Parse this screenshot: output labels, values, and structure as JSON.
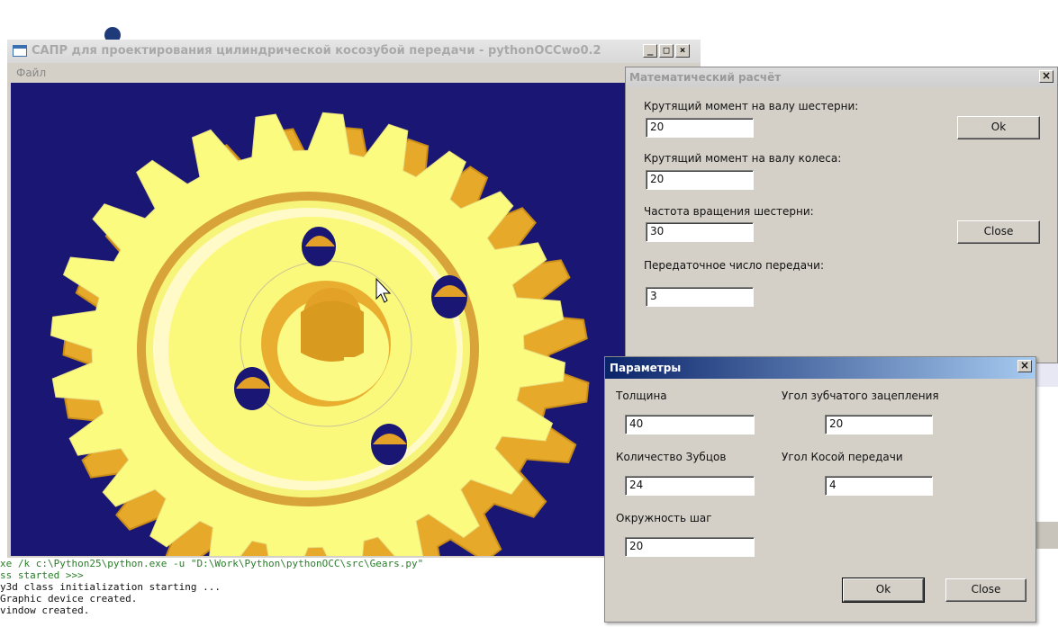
{
  "main_window": {
    "title": "САПР для проектирования цилиндрической косозубой передачи - pythonOCCwo0.2",
    "menu": {
      "file": "Файл"
    },
    "buttons": {
      "minimize": "_",
      "maximize": "□",
      "close": "×"
    }
  },
  "gear": {
    "teeth_count": 24,
    "colors": {
      "face": "#fbfb80",
      "side": "#e6a92a",
      "shadow": "#c88c18",
      "background": "#1a1673"
    }
  },
  "console": {
    "lines": [
      "xe /k c:\\Python25\\python.exe -u \"D:\\Work\\Python\\pythonOCC\\src\\Gears.py\"",
      "ss started >>>",
      "y3d class initialization starting ...",
      "Graphic device created.",
      "vindow created."
    ]
  },
  "math_dialog": {
    "title": "Математический расчёт",
    "close": "×",
    "fields": [
      {
        "label": "Крутящий момент на валу шестерни:",
        "value": "20"
      },
      {
        "label": "Крутящий момент на валу колеса:",
        "value": "20"
      },
      {
        "label": "Частота вращения шестерни:",
        "value": "30"
      },
      {
        "label": "Передаточное число передачи:",
        "value": "3"
      }
    ],
    "ok_label": "Ok",
    "close_label": "Close"
  },
  "params_dialog": {
    "title": "Параметры",
    "close": "×",
    "thickness": {
      "label": "Толщина",
      "value": "40"
    },
    "teeth": {
      "label": "Количество Зубцов",
      "value": "24"
    },
    "pitch_circle": {
      "label": "Окружность шаг",
      "value": "20"
    },
    "mesh_angle": {
      "label": "Угол зубчатого зацепления",
      "value": "20"
    },
    "helix_angle": {
      "label": "Угол Косой передачи",
      "value": "4"
    },
    "ok_label": "Ok",
    "close_label": "Close"
  }
}
